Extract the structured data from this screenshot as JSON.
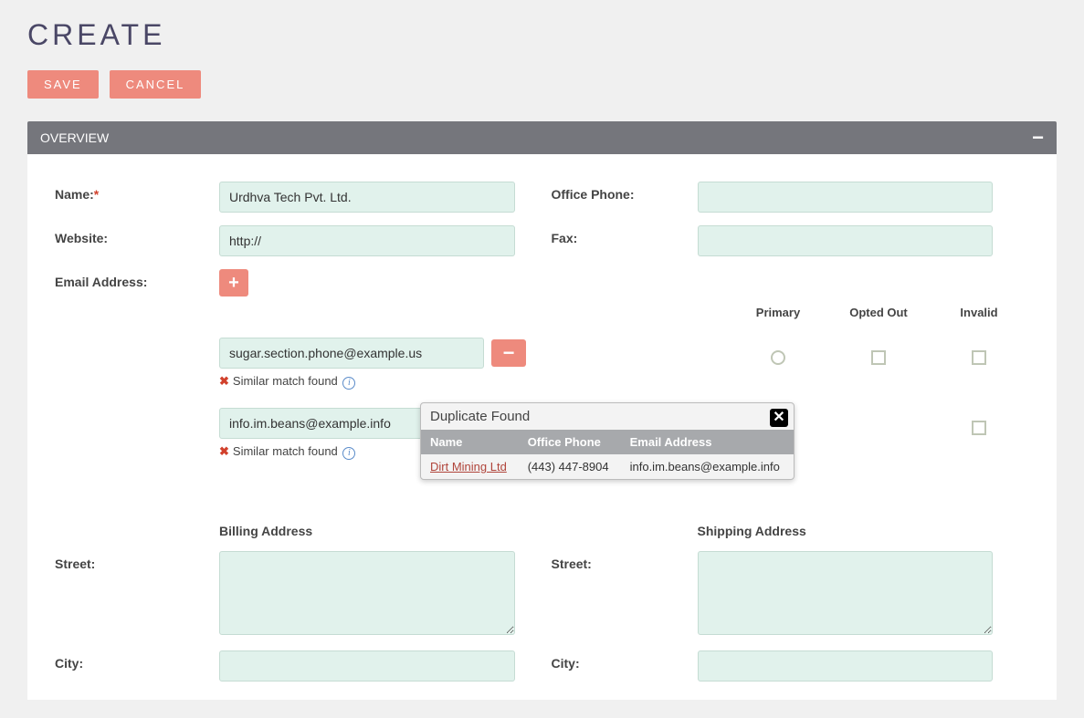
{
  "page_title": "CREATE",
  "buttons": {
    "save": "SAVE",
    "cancel": "CANCEL"
  },
  "section": {
    "overview": "OVERVIEW"
  },
  "labels": {
    "name": "Name:",
    "required_mark": "*",
    "website": "Website:",
    "email": "Email Address:",
    "office_phone": "Office Phone:",
    "fax": "Fax:",
    "billing_address": "Billing Address",
    "shipping_address": "Shipping Address",
    "street": "Street:",
    "city": "City:"
  },
  "values": {
    "name": "Urdhva Tech Pvt. Ltd.",
    "website": "http://",
    "office_phone": "",
    "fax": "",
    "billing_street": "",
    "billing_city": "",
    "shipping_street": "",
    "shipping_city": ""
  },
  "email_columns": {
    "primary": "Primary",
    "opted_out": "Opted Out",
    "invalid": "Invalid"
  },
  "emails": [
    {
      "value": "sugar.section.phone@example.us",
      "match_text": "Similar match found"
    },
    {
      "value": "info.im.beans@example.info",
      "match_text": "Similar match found"
    }
  ],
  "tooltip": {
    "title": "Duplicate Found",
    "columns": {
      "name": "Name",
      "office_phone": "Office Phone",
      "email": "Email Address"
    },
    "row": {
      "name": "Dirt Mining Ltd",
      "phone": "(443) 447-8904",
      "email": "info.im.beans@example.info"
    }
  }
}
